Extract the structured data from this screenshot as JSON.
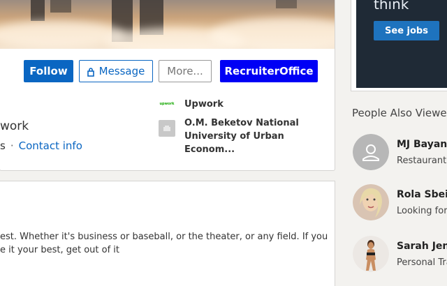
{
  "actions": {
    "follow": "Follow",
    "message": "Message",
    "more": "More...",
    "recruiter": "RecruiterOffice"
  },
  "profile": {
    "headline_partial": "work",
    "connections_partial": "s",
    "separator": "·",
    "contact_info": "Contact info"
  },
  "experience": {
    "company": "Upwork",
    "company_logo_text": "upwork",
    "school": "O.M. Beketov National University of Urban Econom..."
  },
  "about": {
    "line1": "est. Whether it's business or baseball, or the theater, or any field. If you",
    "line2": "e it your best, get out of it"
  },
  "ad": {
    "text": "think",
    "button": "See jobs"
  },
  "people_also_viewed": {
    "heading": "People Also Viewed",
    "items": [
      {
        "name": "MJ Bayani",
        "subtitle": "Restaurant S"
      },
      {
        "name": "Rola Sbeit",
        "subtitle": "Looking for"
      },
      {
        "name": "Sarah Jenl",
        "subtitle": "Personal Tra"
      }
    ]
  }
}
